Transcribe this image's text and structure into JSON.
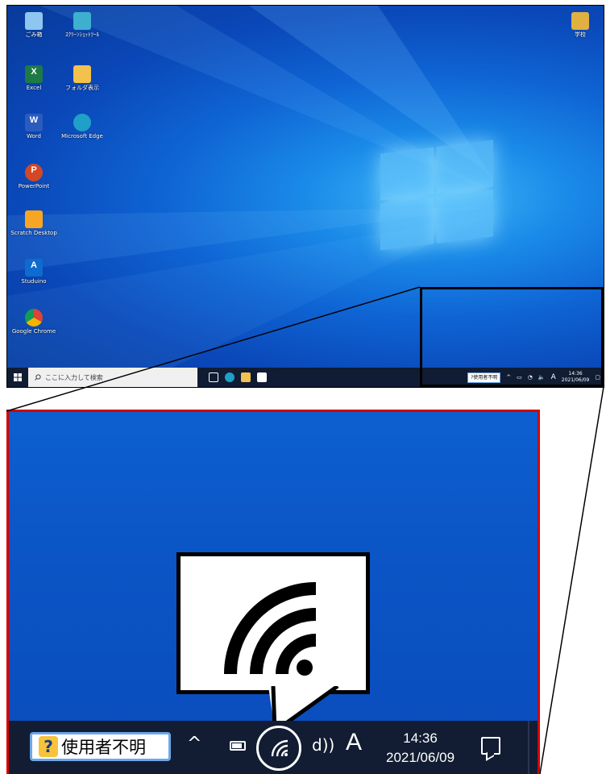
{
  "desktop": {
    "icons": [
      {
        "label": "ごみ箱",
        "color": "#8fc6ef",
        "glyph": "🗑"
      },
      {
        "label": "ｽｸﾘｰﾝｼｮｯﾄﾂｰﾙ",
        "color": "#3db0d0",
        "glyph": ""
      },
      {
        "label": "Excel",
        "color": "#1d7a45",
        "glyph": "X"
      },
      {
        "label": "フォルダ表示",
        "color": "#f2c14e",
        "glyph": ""
      },
      {
        "label": "Word",
        "color": "#2a5cbf",
        "glyph": "W"
      },
      {
        "label": "Microsoft Edge",
        "color": "#1fa0c8",
        "glyph": ""
      },
      {
        "label": "PowerPoint",
        "color": "#d24726",
        "glyph": "P"
      },
      {
        "label": "Scratch Desktop",
        "color": "#f6a623",
        "glyph": ""
      },
      {
        "label": "Studuino",
        "color": "#0e6bd0",
        "glyph": "A"
      },
      {
        "label": "Google Chrome",
        "color": "#e8b000",
        "glyph": ""
      },
      {
        "label": "学校",
        "color": "#e0b040",
        "glyph": ""
      }
    ],
    "taskbar": {
      "search_placeholder": "ここに入力して検索",
      "user_status": "?使用者不明",
      "time": "14:36",
      "date": "2021/06/09",
      "ime": "A"
    }
  },
  "zoom": {
    "user_status": "使用者不明",
    "user_status_icon": "?",
    "chevron": "^",
    "volume": "\u0001f50a",
    "ime": "A",
    "time": "14:36",
    "date": "2021/06/09"
  },
  "colors": {
    "highlight_border": "#d40000",
    "taskbar": "#121d33",
    "desktop_blue": "#0b55c6"
  },
  "icons": {
    "wifi": "wifi-icon",
    "battery": "battery-icon",
    "notification": "notification-icon"
  }
}
